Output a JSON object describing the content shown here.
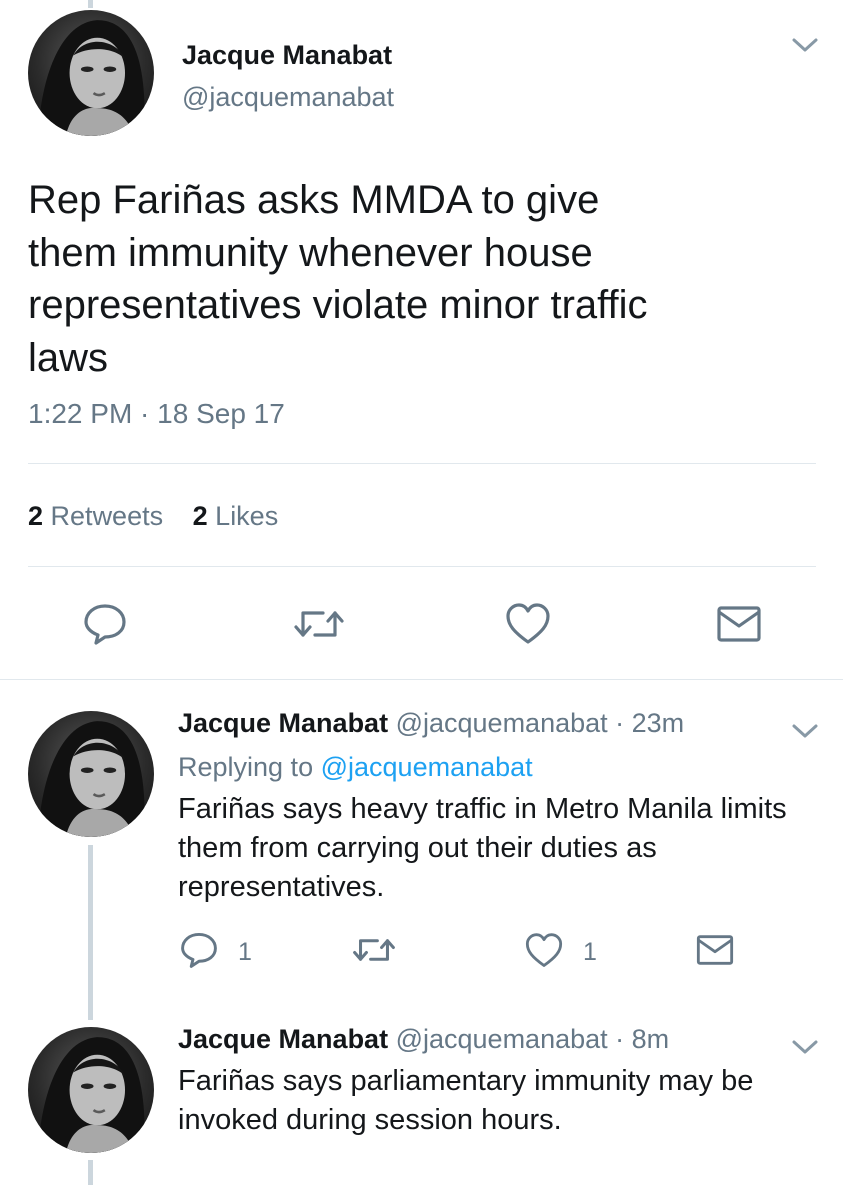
{
  "main_tweet": {
    "author_name": "Jacque Manabat",
    "author_handle": "@jacquemanabat",
    "text_lines": [
      "Rep Fariñas asks MMDA to give",
      "them immunity whenever house",
      "representatives violate minor traffic",
      "laws"
    ],
    "timestamp": "1:22 PM · 18 Sep 17",
    "retweets_count": "2",
    "retweets_label": "Retweets",
    "likes_count": "2",
    "likes_label": "Likes"
  },
  "replies": [
    {
      "author_name": "Jacque Manabat",
      "author_handle": "@jacquemanabat",
      "time": "· 23m",
      "replying_prefix": "Replying to",
      "replying_handle": "@jacquemanabat",
      "text_lines": [
        "Fariñas says heavy traffic in Metro Manila limits",
        "them from carrying out their duties as",
        "representatives."
      ],
      "reply_count": "1",
      "like_count": "1"
    },
    {
      "author_name": "Jacque Manabat",
      "author_handle": "@jacquemanabat",
      "time": "· 8m",
      "text_lines": [
        "Fariñas says parliamentary immunity may be",
        "invoked during session hours."
      ]
    }
  ],
  "colors": {
    "text": "#14171a",
    "muted": "#657786",
    "link": "#1da1f2",
    "divider": "#e1e8ed",
    "thread_line": "#ccd6dd"
  },
  "icons": [
    "chevron-down-icon",
    "reply-icon",
    "retweet-icon",
    "like-icon",
    "direct-message-icon"
  ]
}
